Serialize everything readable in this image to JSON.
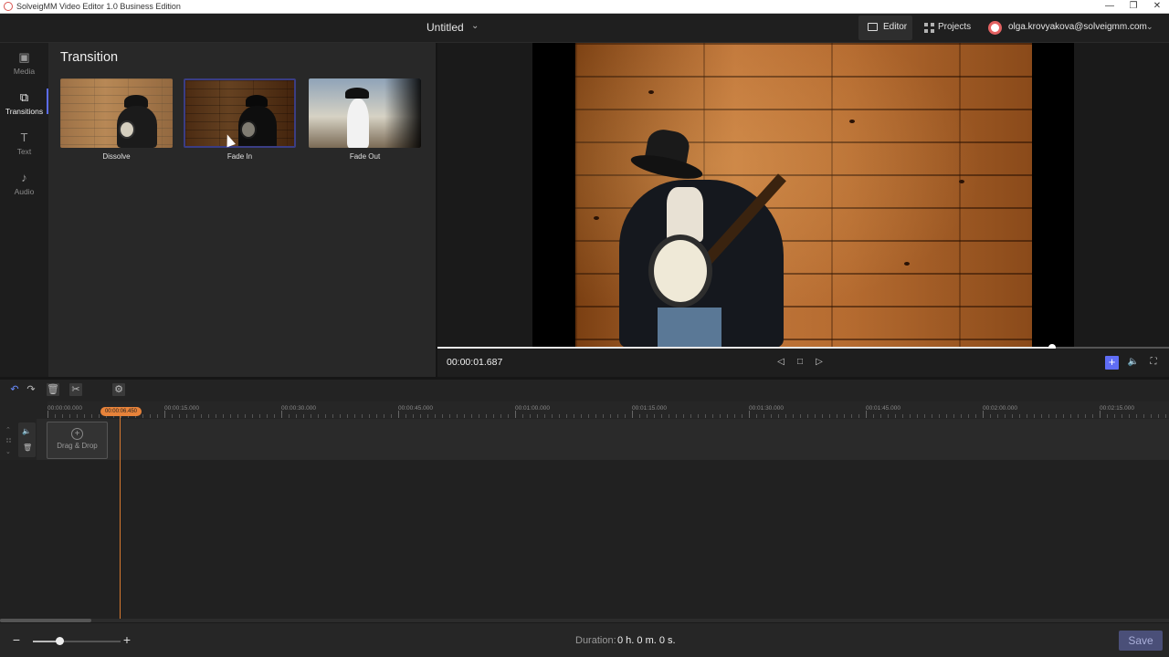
{
  "window": {
    "title": "SolveigMM Video Editor 1.0 Business Edition",
    "minimize": "—",
    "restore": "❐",
    "close": "✕"
  },
  "header": {
    "project_title": "Untitled",
    "tabs": [
      {
        "label": "Editor",
        "active": true
      },
      {
        "label": "Projects",
        "active": false
      }
    ],
    "user_email": "olga.krovyakova@solveigmm.com"
  },
  "sidebar": {
    "items": [
      {
        "label": "Media",
        "icon": "image-icon",
        "glyph": "▣"
      },
      {
        "label": "Transitions",
        "icon": "transitions-icon",
        "glyph": "⧉"
      },
      {
        "label": "Text",
        "icon": "text-icon",
        "glyph": "T"
      },
      {
        "label": "Audio",
        "icon": "music-note-icon",
        "glyph": "♪"
      }
    ],
    "active": "Transitions"
  },
  "transition_panel": {
    "title": "Transition",
    "items": [
      {
        "label": "Dissolve",
        "selected": false
      },
      {
        "label": "Fade In",
        "selected": true
      },
      {
        "label": "Fade Out",
        "selected": false
      }
    ]
  },
  "preview": {
    "timecode": "00:00:01.687",
    "progress": 0.84,
    "controls": {
      "prev_frame": "◁",
      "stop": "□",
      "next_frame": "▷",
      "add": "+",
      "volume": "🔈",
      "fullscreen": "⛶"
    }
  },
  "timeline": {
    "tick_labels": [
      "00:00:00.000",
      "00:00:15.000",
      "00:00:30.000",
      "00:00:45.000",
      "00:01:00.000",
      "00:01:15.000",
      "00:01:30.000",
      "00:01:45.000",
      "00:02:00.000",
      "00:02:15.000"
    ],
    "playhead_label": "00:00:06.450",
    "dropzone_label": "Drag & Drop",
    "dropzone_plus": "+"
  },
  "bottom": {
    "zoom_minus": "−",
    "zoom_plus": "+",
    "zoom_level": 0.3,
    "duration_label": "Duration:",
    "duration_value": "0 h. 0 m. 0 s.",
    "save_label": "Save"
  },
  "colors": {
    "accent": "#5f6df5",
    "playhead": "#e8833a",
    "save_disabled": "#4a4f78"
  }
}
